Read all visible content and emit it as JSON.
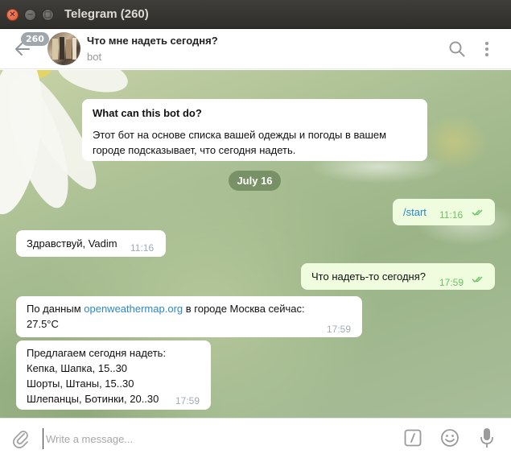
{
  "window": {
    "title": "Telegram (260)"
  },
  "header": {
    "unread_count": "260",
    "chat_title": "Что мне надеть сегодня?",
    "chat_subtitle": "bot"
  },
  "bot_info": {
    "heading": "What can this bot do?",
    "body": "Этот бот на основе списка вашей одежды и погоды в вашем городе подсказывает, что сегодня надеть."
  },
  "date_separator": "July 16",
  "messages": [
    {
      "dir": "out",
      "text": "/start",
      "time": "11:16",
      "read": true
    },
    {
      "dir": "in",
      "text": "Здравствуй, Vadim",
      "time": "11:16"
    },
    {
      "dir": "out",
      "text": "Что надеть-то сегодня?",
      "time": "17:59",
      "read": true
    },
    {
      "dir": "in",
      "text_before_link": "По данным ",
      "link": "openweathermap.org",
      "text_after_link": " в городе Москва сейчас:",
      "text_line2": "27.5°C",
      "time": "17:59"
    },
    {
      "dir": "in",
      "lines": [
        "Предлагаем сегодня надеть:",
        "Кепка, Шапка, 15..30",
        "Шорты, Штаны, 15..30",
        "Шлепанцы, Ботинки, 20..30"
      ],
      "time": "17:59"
    }
  ],
  "compose": {
    "placeholder": "Write a message..."
  },
  "colors": {
    "accent": "#2a88c8",
    "outgoing_bubble": "#effdde",
    "read_check": "#6cc264"
  }
}
